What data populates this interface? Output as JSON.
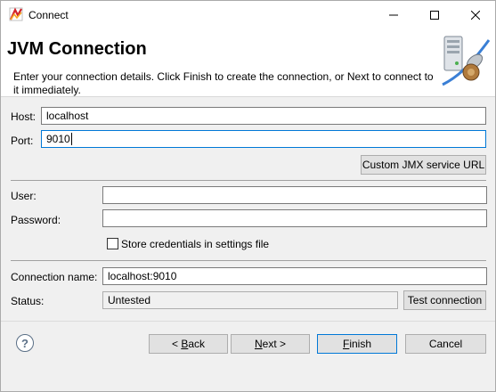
{
  "window": {
    "title": "Connect"
  },
  "banner": {
    "title": "JVM Connection",
    "description": "Enter your connection details. Click Finish to create the connection, or Next to connect to it immediately."
  },
  "form": {
    "host_label": "Host:",
    "host_value": "localhost",
    "port_label": "Port:",
    "port_value": "9010",
    "custom_jmx_button": "Custom JMX service URL",
    "user_label": "User:",
    "user_value": "",
    "password_label": "Password:",
    "password_value": "",
    "store_credentials_label": "Store credentials in settings file",
    "store_credentials_checked": false,
    "connection_name_label": "Connection name:",
    "connection_name_value": "localhost:9010",
    "status_label": "Status:",
    "status_value": "Untested",
    "test_connection_button": "Test connection"
  },
  "footer": {
    "help_icon": "?",
    "back_prefix": "< ",
    "back_mnemonic": "B",
    "back_rest": "ack",
    "next_mnemonic": "N",
    "next_rest": "ext >",
    "finish_mnemonic": "F",
    "finish_rest": "inish",
    "cancel_label": "Cancel"
  },
  "icons": {
    "app": "jmc-app-icon",
    "banner": "server-connection-icon",
    "minimize": "minimize-icon",
    "maximize": "maximize-icon",
    "close": "close-icon",
    "help": "help-icon"
  },
  "colors": {
    "focus_border": "#0078d7",
    "window_bg": "#f0f0f0",
    "banner_bg": "#ffffff"
  }
}
